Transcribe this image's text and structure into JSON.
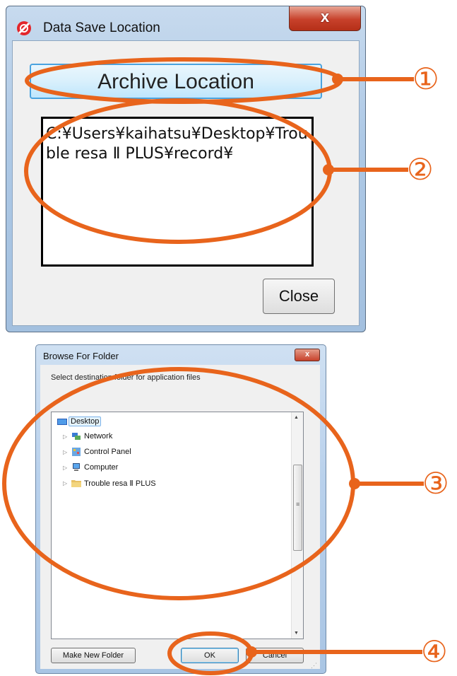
{
  "dialog1": {
    "title": "Data Save Location",
    "close_glyph": "x",
    "archive_button": "Archive Location",
    "path": "C:¥Users¥kaihatsu¥Desktop¥Trouble resa Ⅱ PLUS¥record¥",
    "close_button": "Close"
  },
  "dialog2": {
    "title": "Browse For Folder",
    "close_glyph": "x",
    "instruction": "Select destination folder for application files",
    "tree": {
      "root": "Desktop",
      "items": [
        "Network",
        "Control Panel",
        "Computer",
        "Trouble resa Ⅱ PLUS"
      ]
    },
    "make_new_folder_button": "Make New Folder",
    "ok_button": "OK",
    "cancel_button": "Cancel"
  },
  "annotations": [
    "①",
    "②",
    "③",
    "④"
  ],
  "colors": {
    "annotation": "#e8641c",
    "selection": "#e5f3fb"
  }
}
